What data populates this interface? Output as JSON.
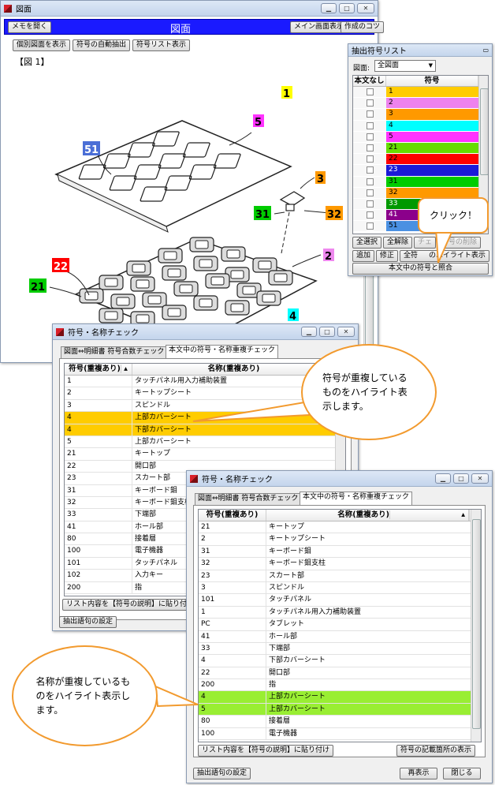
{
  "main": {
    "title_small": "図面",
    "header": {
      "memo_button": "メモを開く",
      "title": "図面",
      "main_view_button": "メイン画面表示",
      "tips_button": "作成のコツ"
    },
    "toolbar": {
      "show_individual": "個別図面を表示",
      "auto_extract": "符号の自動抽出",
      "show_list": "符号リスト表示"
    },
    "figure_label": "【図 1】",
    "reference_labels": [
      {
        "text": "1",
        "color": "#ffff00"
      },
      {
        "text": "5",
        "color": "#ff33ff"
      },
      {
        "text": "51",
        "color": "#4a6ed6"
      },
      {
        "text": "3",
        "color": "#ff9900"
      },
      {
        "text": "31",
        "color": "#00cc00"
      },
      {
        "text": "32",
        "color": "#ff9900"
      },
      {
        "text": "2",
        "color": "#ee88ee"
      },
      {
        "text": "22",
        "color": "#ff0000"
      },
      {
        "text": "21",
        "color": "#00cc00"
      },
      {
        "text": "4",
        "color": "#00ffff"
      }
    ]
  },
  "list_window": {
    "title": "抽出符号リスト",
    "drawing_label": "図面:",
    "drawing_value": "全図面",
    "col_no_text": "本文なし",
    "col_symbol": "符号",
    "rows": [
      {
        "symbol": "1",
        "color": "#ffcc00"
      },
      {
        "symbol": "2",
        "color": "#ee82ee"
      },
      {
        "symbol": "3",
        "color": "#ff9900"
      },
      {
        "symbol": "4",
        "color": "#00ffff"
      },
      {
        "symbol": "5",
        "color": "#ff33ff"
      },
      {
        "symbol": "21",
        "color": "#66dd00"
      },
      {
        "symbol": "22",
        "color": "#ff0000"
      },
      {
        "symbol": "23",
        "color": "#1a1ad8"
      },
      {
        "symbol": "31",
        "color": "#00cc00"
      },
      {
        "symbol": "32",
        "color": "#ff9900"
      },
      {
        "symbol": "33",
        "color": "#009900"
      },
      {
        "symbol": "41",
        "color": "#8b008b"
      },
      {
        "symbol": "51",
        "color": "#4a90e2"
      }
    ],
    "btn_select_all": "全選択",
    "btn_clear_all": "全解除",
    "btn_check": "チェ",
    "btn_delete": "符号の削除",
    "btn_add": "追加",
    "btn_edit": "修正",
    "btn_highlight_left": "全符",
    "btn_highlight_right": "のハイライト表示",
    "btn_match": "本文中の符号と照合"
  },
  "win1": {
    "title": "符号・名称チェック",
    "tab1": "図面⇔明細書 符号合数チェック",
    "tab2": "本文中の符号・名称重複チェック",
    "col_symbol": "符号(重複あり)",
    "col_name": "名称(重複あり)",
    "rows": [
      {
        "symbol": "1",
        "name": "タッチパネル用入力補助装置",
        "hl": ""
      },
      {
        "symbol": "2",
        "name": "キートップシート",
        "hl": ""
      },
      {
        "symbol": "3",
        "name": "スピンドル",
        "hl": ""
      },
      {
        "symbol": "4",
        "name": "上部カバーシート",
        "hl": "#ffcc00"
      },
      {
        "symbol": "4",
        "name": "下部カバーシート",
        "hl": "#ffcc00"
      },
      {
        "symbol": "5",
        "name": "上部カバーシート",
        "hl": ""
      },
      {
        "symbol": "21",
        "name": "キートップ",
        "hl": ""
      },
      {
        "symbol": "22",
        "name": "開口部",
        "hl": ""
      },
      {
        "symbol": "23",
        "name": "スカート部",
        "hl": ""
      },
      {
        "symbol": "31",
        "name": "キーボード鉬",
        "hl": ""
      },
      {
        "symbol": "32",
        "name": "キーボード鉬支柱",
        "hl": ""
      },
      {
        "symbol": "33",
        "name": "下端部",
        "hl": ""
      },
      {
        "symbol": "41",
        "name": "ホール部",
        "hl": ""
      },
      {
        "symbol": "80",
        "name": "接着層",
        "hl": ""
      },
      {
        "symbol": "100",
        "name": "電子機器",
        "hl": ""
      },
      {
        "symbol": "101",
        "name": "タッチパネル",
        "hl": ""
      },
      {
        "symbol": "102",
        "name": "入力キー",
        "hl": ""
      },
      {
        "symbol": "200",
        "name": "指",
        "hl": ""
      }
    ],
    "btn_paste": "リスト内容を【符号の説明】に貼り付け",
    "btn_settings": "抽出語句の設定"
  },
  "win2": {
    "title": "符号・名称チェック",
    "tab1": "図面⇔明細書 符号合数チェック",
    "tab2": "本文中の符号・名称重複チェック",
    "col_symbol": "符号(重複あり)",
    "col_name": "名称(重複あり)",
    "rows": [
      {
        "symbol": "21",
        "name": "キートップ",
        "hl": ""
      },
      {
        "symbol": "2",
        "name": "キートップシート",
        "hl": ""
      },
      {
        "symbol": "31",
        "name": "キーボード鉬",
        "hl": ""
      },
      {
        "symbol": "32",
        "name": "キーボード鉬支柱",
        "hl": ""
      },
      {
        "symbol": "23",
        "name": "スカート部",
        "hl": ""
      },
      {
        "symbol": "3",
        "name": "スピンドル",
        "hl": ""
      },
      {
        "symbol": "101",
        "name": "タッチパネル",
        "hl": ""
      },
      {
        "symbol": "1",
        "name": "タッチパネル用入力補助装置",
        "hl": ""
      },
      {
        "symbol": "PC",
        "name": "タブレット",
        "hl": ""
      },
      {
        "symbol": "41",
        "name": "ホール部",
        "hl": ""
      },
      {
        "symbol": "33",
        "name": "下端部",
        "hl": ""
      },
      {
        "symbol": "4",
        "name": "下部カバーシート",
        "hl": ""
      },
      {
        "symbol": "22",
        "name": "開口部",
        "hl": ""
      },
      {
        "symbol": "200",
        "name": "指",
        "hl": ""
      },
      {
        "symbol": "4",
        "name": "上部カバーシート",
        "hl": "#99ee33"
      },
      {
        "symbol": "5",
        "name": "上部カバーシート",
        "hl": "#99ee33"
      },
      {
        "symbol": "80",
        "name": "接着層",
        "hl": ""
      },
      {
        "symbol": "100",
        "name": "電子機器",
        "hl": ""
      }
    ],
    "btn_paste": "リスト内容を【符号の説明】に貼り付け",
    "btn_locations": "符号の記載箇所の表示",
    "btn_settings": "抽出語句の設定",
    "btn_refresh": "再表示",
    "btn_close": "閉じる"
  },
  "callouts": {
    "click": "クリック！",
    "symbol_dup": "符号が重複しているものをハイライト表示します。",
    "name_dup": "名称が重複しているものをハイライト表示します。"
  }
}
